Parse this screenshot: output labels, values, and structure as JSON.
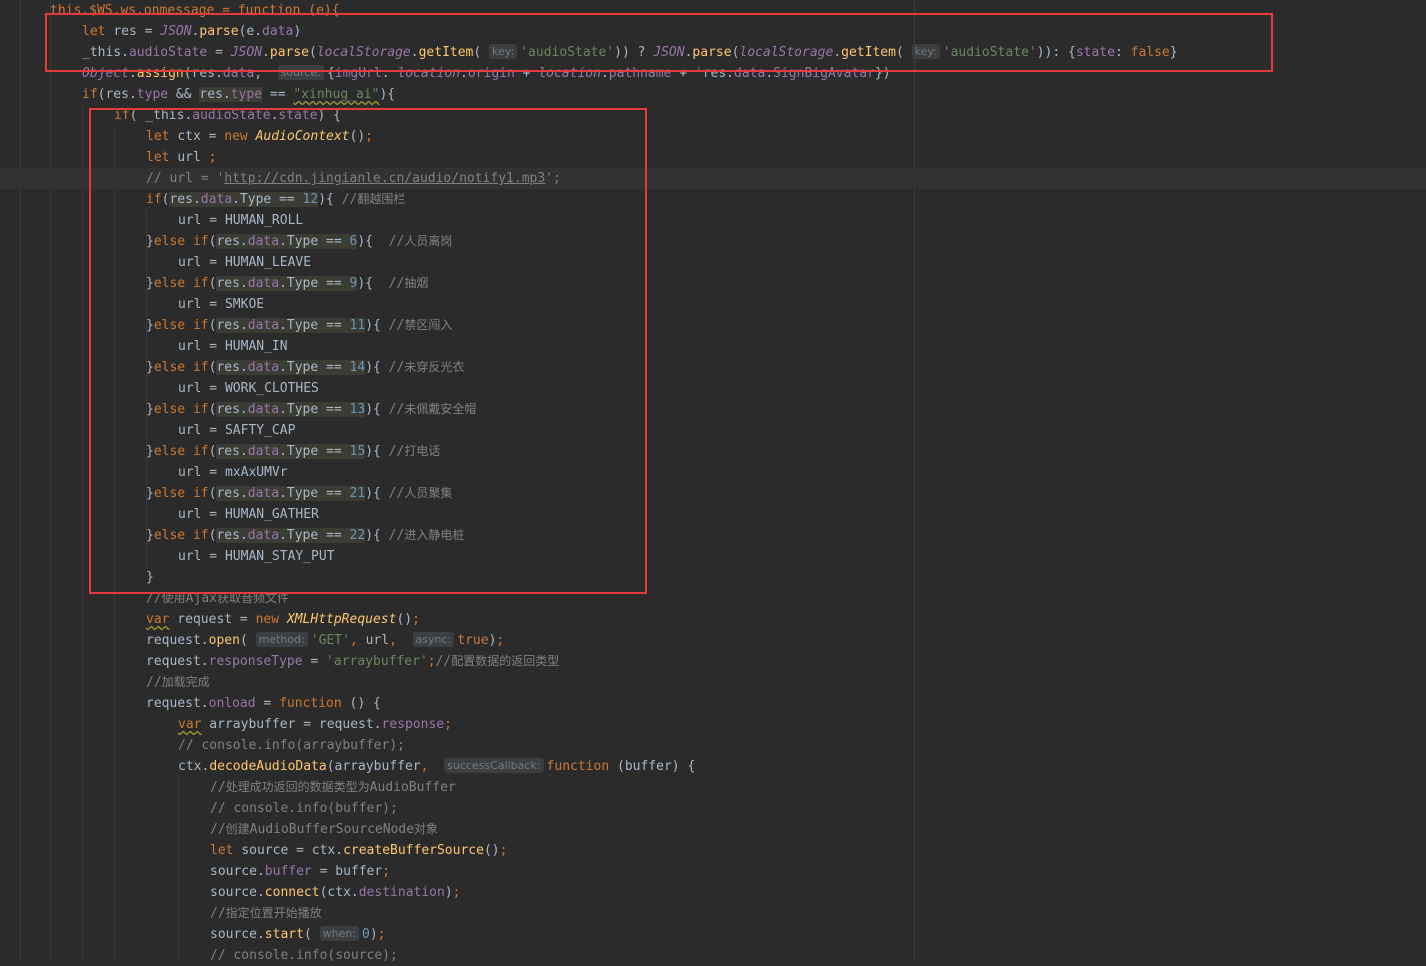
{
  "code_lines": [
    "this.$WS.ws.onmessage = function (e){",
    "let res = JSON.parse(e.data)",
    "_this.audioState = JSON.parse(localStorage.getItem( key: 'audioState')) ? JSON.parse(localStorage.getItem( key: 'audioState')): {state: false}",
    "Object.assign(res.data,  source: {imgUrl: location.origin + location.pathname + 'res.data.SignBigAvatar})",
    "if(res.type && res.type == \"xinhug_ai\"){",
    "if( _this.audioState.state) {",
    "let ctx = new AudioContext();",
    "let url ;",
    "// url = 'http://cdn.jingianle.cn/audio/notify1.mp3';",
    "if(res.data.Type == 12){ //翻越围栏",
    "url = HUMAN_ROLL",
    "}else if(res.data.Type == 6){  //人员离岗",
    "url = HUMAN_LEAVE",
    "}else if(res.data.Type == 9){  //抽烟",
    "url = SMKOE",
    "}else if(res.data.Type == 11){ //禁区闯入",
    "url = HUMAN_IN",
    "}else if(res.data.Type == 14){ //未穿反光衣",
    "url = WORK_CLOTHES",
    "}else if(res.data.Type == 13){ //未佩戴安全帽",
    "url = SAFTY_CAP",
    "}else if(res.data.Type == 15){ //打电话",
    "url = mxAxUMVr",
    "}else if(res.data.Type == 21){ //人员聚集",
    "url = HUMAN_GATHER",
    "}else if(res.data.Type == 22){ //进入静电桩",
    "url = HUMAN_STAY_PUT",
    "}",
    "//使用Ajax获取音频文件",
    "var request = new XMLHttpRequest();",
    "request.open( method: 'GET', url,  async: true);",
    "request.responseType = 'arraybuffer';//配置数据的返回类型",
    "//加载完成",
    "request.onload = function () {",
    "var arraybuffer = request.response;",
    "// console.info(arraybuffer);",
    "ctx.decodeAudioData(arraybuffer,  successCallback: function (buffer) {",
    "//处理成功返回的数据类型为AudioBuffer",
    "// console.info(buffer);",
    "//创建AudioBufferSourceNode对象",
    "let source = ctx.createBufferSource();",
    "source.buffer = buffer;",
    "source.connect(ctx.destination);",
    "//指定位置开始播放",
    "source.start( when: 0);",
    "// console.info(source);"
  ],
  "parameter_hints": {
    "key": "key:",
    "source": "source:",
    "method": "method:",
    "async": "async:",
    "successCallback": "successCallback:",
    "when": "when:"
  },
  "colors": {
    "background": "#2b2b2b",
    "keyword": "#cc7832",
    "function": "#ffc66d",
    "string": "#6a8759",
    "number": "#6897bb",
    "property": "#9876aa",
    "comment": "#808080",
    "text": "#a9b7c6",
    "annotation_box": "#e83a3a"
  }
}
